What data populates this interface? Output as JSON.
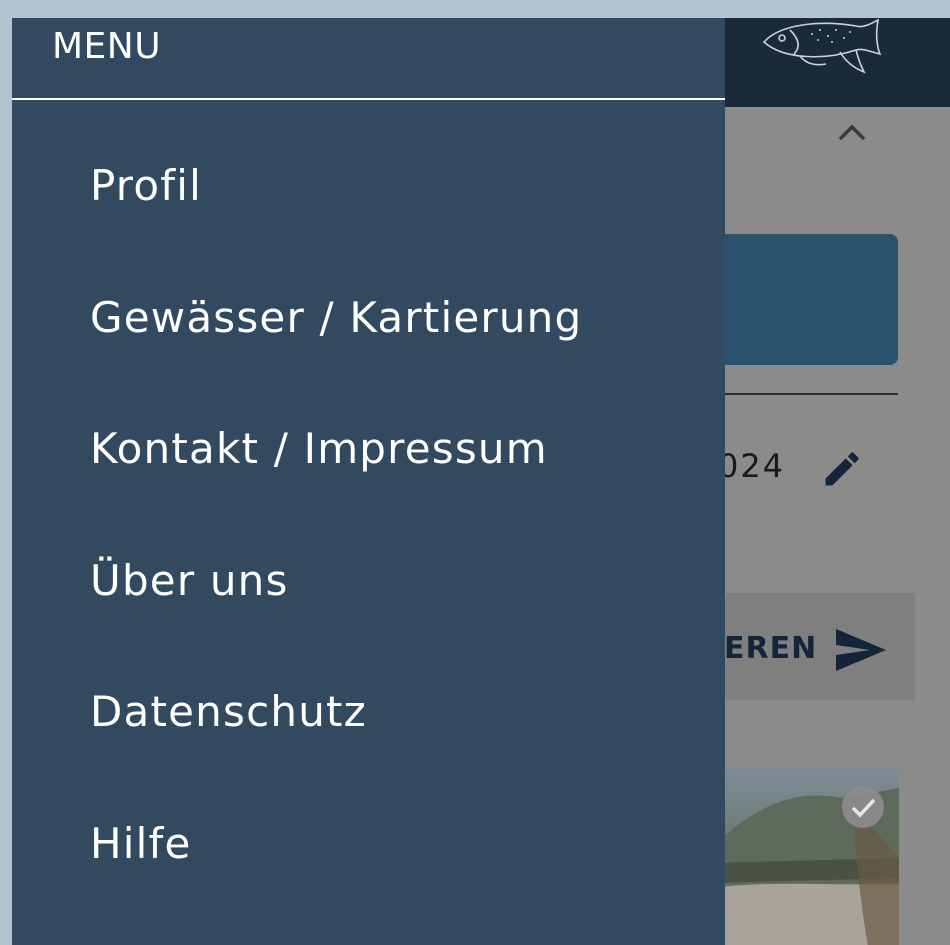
{
  "drawer": {
    "title": "MENU",
    "items": [
      {
        "label": "Profil"
      },
      {
        "label": "Gewässer / Kartierung"
      },
      {
        "label": "Kontakt / Impressum"
      },
      {
        "label": "Über uns"
      },
      {
        "label": "Datenschutz"
      },
      {
        "label": "Hilfe"
      }
    ]
  },
  "background": {
    "date_fragment": "024",
    "send_button_label": "EREN"
  },
  "icons": {
    "logo": "fish-logo-icon",
    "collapse": "chevron-up-icon",
    "edit": "pencil-icon",
    "send": "send-icon",
    "checked": "check-circle-icon"
  },
  "colors": {
    "drawer_bg": "#33495f",
    "header_bg": "#1a2a3b",
    "accent_panel": "#2a526f",
    "outer_bg": "#b3c3d0"
  }
}
